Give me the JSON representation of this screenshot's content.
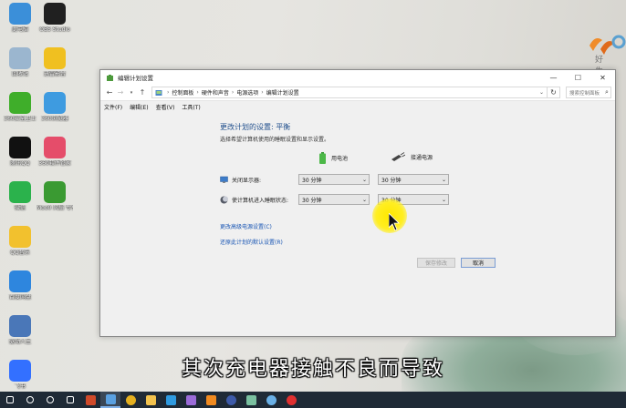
{
  "desktop": {
    "icons": [
      {
        "label": "此电脑",
        "icon": "computer-icon",
        "color": "#3b8fd9"
      },
      {
        "label": "回收站",
        "icon": "recycle-bin-icon",
        "color": "#9bb6cf"
      },
      {
        "label": "360安全卫士",
        "icon": "360-security-icon",
        "color": "#3fae2a"
      },
      {
        "label": "腾讯QQ",
        "icon": "qq-icon",
        "color": "#111111"
      },
      {
        "label": "微信",
        "icon": "wechat-icon",
        "color": "#2bb24c"
      },
      {
        "label": "QQ音乐",
        "icon": "qq-music-icon",
        "color": "#f2c12e"
      },
      {
        "label": "百度网盘",
        "icon": "baidu-netdisk-icon",
        "color": "#2e86de"
      },
      {
        "label": "驱动人生",
        "icon": "driver-icon",
        "color": "#4a77b8"
      },
      {
        "label": "飞书",
        "icon": "feishu-icon",
        "color": "#3370ff"
      },
      {
        "label": "OBS Studio",
        "icon": "obs-icon",
        "color": "#202020"
      },
      {
        "label": "迅雷影音",
        "icon": "thunder-icon",
        "color": "#f0c020"
      },
      {
        "label": "360浏览器",
        "icon": "360-browser-icon",
        "color": "#3e9be0"
      },
      {
        "label": "360软件管家",
        "icon": "360-software-icon",
        "color": "#e54d6a"
      },
      {
        "label": "Moo0 风扇 专享 1.43",
        "icon": "moo0-icon",
        "color": "#3a9a32"
      }
    ]
  },
  "watermark": {
    "text": "好 生"
  },
  "window": {
    "title": "编辑计划设置",
    "buttons": {
      "minimize": "—",
      "maximize": "☐",
      "close": "✕"
    },
    "address": {
      "crumbs": [
        "控制面板",
        "硬件和声音",
        "电源选项",
        "编辑计划设置"
      ]
    },
    "search_placeholder": "搜索控制面板",
    "menu": [
      "文件(F)",
      "编辑(E)",
      "查看(V)",
      "工具(T)"
    ],
    "content": {
      "heading": "更改计划的设置: 平衡",
      "subtext": "选择希望计算机使用的睡眠设置和显示设置。",
      "col_battery": "用电池",
      "col_plugged": "接通电源",
      "rows": [
        {
          "label": "关闭显示器:",
          "icon": "monitor-icon",
          "battery": "30 分钟",
          "plugged": "30 分钟"
        },
        {
          "label": "使计算机进入睡眠状态:",
          "icon": "moon-icon",
          "battery": "30 分钟",
          "plugged": "30 分钟"
        }
      ],
      "link_advanced": "更改高级电源设置(C)",
      "link_restore": "还原此计划的默认设置(R)",
      "btn_save": "保存修改",
      "btn_cancel": "取消"
    }
  },
  "subtitle": "其次充电器接触不良而导致",
  "taskbar": {
    "items": [
      {
        "icon": "windows-start-icon",
        "color": "#ffffff"
      },
      {
        "icon": "search-icon",
        "color": "#ffffff"
      },
      {
        "icon": "cortana-icon",
        "color": "#ffffff"
      },
      {
        "icon": "task-view-icon",
        "color": "#ffffff"
      },
      {
        "icon": "powerpoint-icon",
        "color": "#d04a2a"
      },
      {
        "icon": "control-panel-icon",
        "color": "#5aa0e0"
      },
      {
        "icon": "chrome-icon",
        "color": "#e5b020"
      },
      {
        "icon": "explorer-icon",
        "color": "#f2c24e"
      },
      {
        "icon": "photoshop-icon",
        "color": "#2f9ae0"
      },
      {
        "icon": "premiere-icon",
        "color": "#9a6bd8"
      },
      {
        "icon": "illustrator-icon",
        "color": "#f08a20"
      },
      {
        "icon": "cinema4d-icon",
        "color": "#3d5aa8"
      },
      {
        "icon": "app-icon",
        "color": "#7ac0a0"
      },
      {
        "icon": "cloud-icon",
        "color": "#6ab0e6"
      },
      {
        "icon": "recorder-icon",
        "color": "#e03030"
      }
    ]
  }
}
